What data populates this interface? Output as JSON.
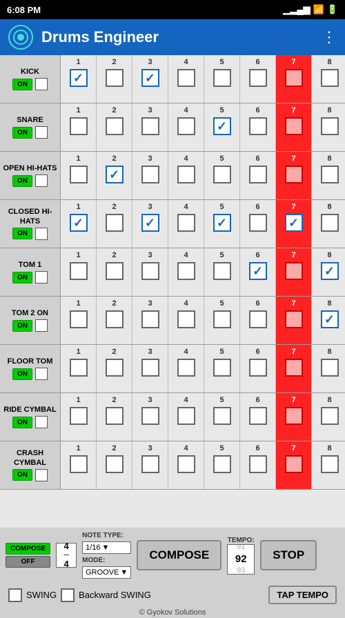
{
  "statusBar": {
    "time": "6:08 PM",
    "battery": "100"
  },
  "titleBar": {
    "appName": "Drums Engineer",
    "menuIcon": "⋮"
  },
  "drums": [
    {
      "id": "kick",
      "name": "KICK",
      "checked": [
        true,
        false,
        true,
        false,
        false,
        false,
        false,
        false
      ]
    },
    {
      "id": "snare",
      "name": "SNARE",
      "checked": [
        false,
        false,
        false,
        false,
        true,
        false,
        false,
        false
      ]
    },
    {
      "id": "open-hi-hats",
      "name": "OPEN HI-HATS",
      "checked": [
        false,
        true,
        false,
        false,
        false,
        false,
        false,
        false
      ]
    },
    {
      "id": "closed-hi-hats",
      "name": "CLOSED HI-HATS",
      "checked": [
        true,
        false,
        true,
        false,
        true,
        false,
        true,
        false
      ]
    },
    {
      "id": "tom1",
      "name": "TOM 1",
      "checked": [
        false,
        false,
        false,
        false,
        false,
        true,
        false,
        true
      ]
    },
    {
      "id": "tom2",
      "name": "TOM 2 ON",
      "checked": [
        false,
        false,
        false,
        false,
        false,
        false,
        false,
        true
      ]
    },
    {
      "id": "floor-tom",
      "name": "FLOOR TOM",
      "checked": [
        false,
        false,
        false,
        false,
        false,
        false,
        false,
        false
      ]
    },
    {
      "id": "ride-cymbal",
      "name": "RIDE CYMBAL",
      "checked": [
        false,
        false,
        false,
        false,
        false,
        false,
        false,
        false
      ]
    },
    {
      "id": "crash-cymbal",
      "name": "CRASH CYMBAL",
      "checked": [
        false,
        false,
        false,
        false,
        false,
        false,
        false,
        false
      ]
    }
  ],
  "columns": [
    1,
    2,
    3,
    4,
    5,
    6,
    7,
    8
  ],
  "redColumn": 7,
  "bottomControls": {
    "timeSig": "4/4",
    "noteTypeLabel": "NOTE TYPE:",
    "noteType": "1/16",
    "modeLabel": "MODE:",
    "mode": "GROOVE",
    "composeLabel": "COMPOSE",
    "tempoLabel": "TEMPO:",
    "tempoValues": [
      "91",
      "92",
      "93"
    ],
    "activeTempoIndex": 1,
    "stopLabel": "STOP",
    "swingLabel": "SWING",
    "backwardSwingLabel": "Backward SWING",
    "tapTempoLabel": "TAP TEMPO",
    "footer": "© Gyokov Solutions"
  }
}
